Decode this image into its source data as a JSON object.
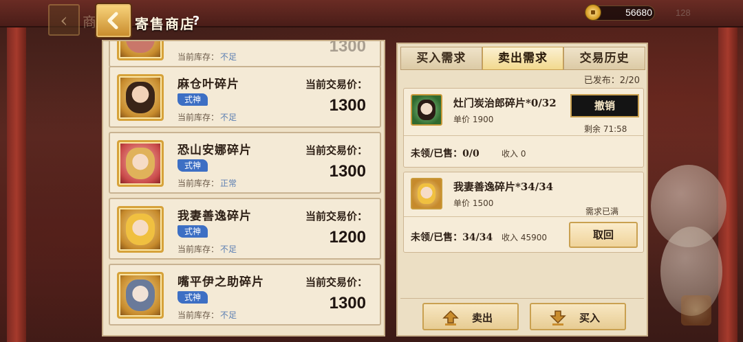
{
  "header": {
    "shop_ghost": "商",
    "title": "寄售商店",
    "help": "?",
    "coins": "56680",
    "faded_number": "128"
  },
  "items": [
    {
      "name": "",
      "tag": "",
      "stock_label": "当前库存：",
      "stock_value": "不足",
      "price_label": "",
      "price": "1300",
      "partial": true,
      "face": "#c9776a"
    },
    {
      "name": "麻仓叶碎片",
      "tag": "式神",
      "stock_label": "当前库存：",
      "stock_value": "不足",
      "price_label": "当前交易价：",
      "price": "1300",
      "face": "#5a3a2a"
    },
    {
      "name": "恐山安娜碎片",
      "tag": "式神",
      "stock_label": "当前库存：",
      "stock_value": "正常",
      "price_label": "当前交易价：",
      "price": "1300",
      "face": "#d44a4a"
    },
    {
      "name": "我妻善逸碎片",
      "tag": "式神",
      "stock_label": "当前库存：",
      "stock_value": "不足",
      "price_label": "当前交易价：",
      "price": "1200",
      "face": "#e6b84a"
    },
    {
      "name": "嘴平伊之助碎片",
      "tag": "式神",
      "stock_label": "当前库存：",
      "stock_value": "不足",
      "price_label": "当前交易价：",
      "price": "1300",
      "face": "#8aa0b8"
    }
  ],
  "tabs": [
    "买入需求",
    "卖出需求",
    "交易历史"
  ],
  "active_tab": 1,
  "published": "已发布：2/20",
  "orders": [
    {
      "name": "灶门炭治郎碎片*0/32",
      "unit_price": "单价  1900",
      "button": "撤销",
      "remaining": "剩余 71:58",
      "sold": "未领/已售：0/0",
      "income": "收入  0",
      "thumb_color": "#3a7a3a"
    },
    {
      "name": "我妻善逸碎片*34/34",
      "unit_price": "单价  1500",
      "note": "需求已满",
      "sold": "未领/已售：34/34",
      "income": "收入  45900",
      "button": "取回",
      "thumb_color": "#d9a83a"
    }
  ],
  "actions": {
    "sell": "卖出",
    "buy": "买入"
  },
  "colors": {
    "accent_gold": "#c9a050",
    "tag_blue": "#3d6fc4",
    "panel_bg": "#efe2c8"
  }
}
